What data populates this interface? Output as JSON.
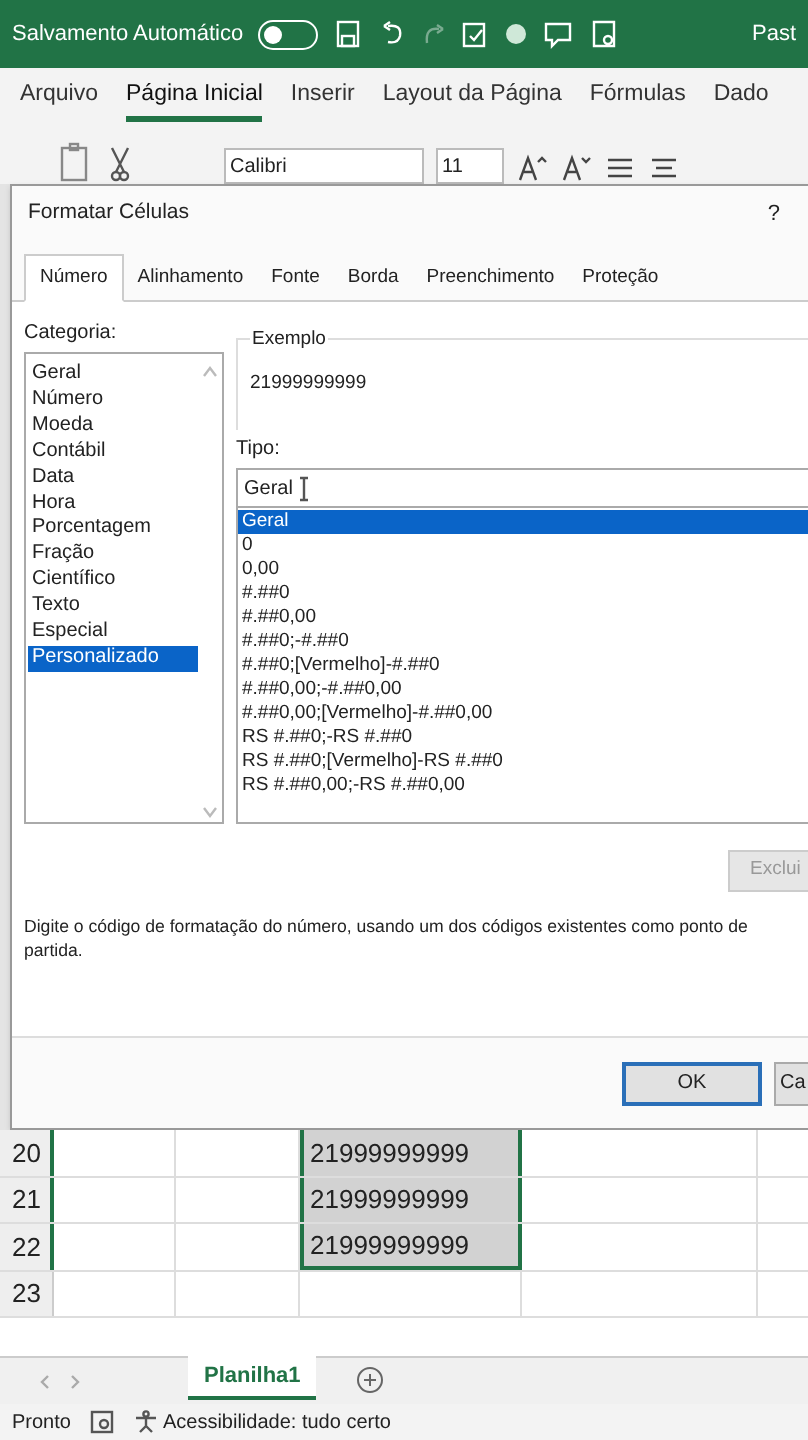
{
  "title_bar": {
    "autosave_label": "Salvamento Automático",
    "autosave_on": false,
    "title": "Past"
  },
  "ribbon_tabs": [
    {
      "label": "Arquivo",
      "selected": false
    },
    {
      "label": "Página Inicial",
      "selected": true
    },
    {
      "label": "Inserir",
      "selected": false
    },
    {
      "label": "Layout da Página",
      "selected": false
    },
    {
      "label": "Fórmulas",
      "selected": false
    },
    {
      "label": "Dado",
      "selected": false
    }
  ],
  "ribbon": {
    "font": "Calibri",
    "size": "11"
  },
  "dialog": {
    "title": "Formatar Células",
    "help": "?",
    "tabs": [
      {
        "label": "Número",
        "selected": true
      },
      {
        "label": "Alinhamento",
        "selected": false
      },
      {
        "label": "Fonte",
        "selected": false
      },
      {
        "label": "Borda",
        "selected": false
      },
      {
        "label": "Preenchimento",
        "selected": false
      },
      {
        "label": "Proteção",
        "selected": false
      }
    ],
    "category_label": "Categoria:",
    "categories": [
      {
        "label": "Geral",
        "selected": false
      },
      {
        "label": "Número",
        "selected": false
      },
      {
        "label": "Moeda",
        "selected": false
      },
      {
        "label": "Contábil",
        "selected": false
      },
      {
        "label": "Data",
        "selected": false
      },
      {
        "label": "Hora",
        "selected": false
      },
      {
        "label": "Porcentagem",
        "selected": false
      },
      {
        "label": "Fração",
        "selected": false
      },
      {
        "label": "Científico",
        "selected": false
      },
      {
        "label": "Texto",
        "selected": false
      },
      {
        "label": "Especial",
        "selected": false
      },
      {
        "label": "Personalizado",
        "selected": true
      }
    ],
    "sample_label": "Exemplo",
    "sample": "21999999999",
    "type_label": "Tipo:",
    "type_value": "Geral",
    "formats": [
      {
        "label": "Geral",
        "selected": true
      },
      {
        "label": "0",
        "selected": false
      },
      {
        "label": "0,00",
        "selected": false
      },
      {
        "label": "#.##0",
        "selected": false
      },
      {
        "label": "#.##0,00",
        "selected": false
      },
      {
        "label": "#.##0;-#.##0",
        "selected": false
      },
      {
        "label": "#.##0;[Vermelho]-#.##0",
        "selected": false
      },
      {
        "label": "#.##0,00;-#.##0,00",
        "selected": false
      },
      {
        "label": "#.##0,00;[Vermelho]-#.##0,00",
        "selected": false
      },
      {
        "label": "RS #.##0;-RS #.##0",
        "selected": false
      },
      {
        "label": "RS #.##0;[Vermelho]-RS #.##0",
        "selected": false
      },
      {
        "label": "RS #.##0,00;-RS #.##0,00",
        "selected": false
      }
    ],
    "delete_button": "Exclui",
    "description": [
      "Digite o código de formatação do número, usando um dos códigos existentes como ponto de",
      "partida."
    ],
    "ok": "OK",
    "cancel": "Ca"
  },
  "sheet": {
    "rows": [
      {
        "number": "20",
        "value": "21999999999",
        "selected": true
      },
      {
        "number": "21",
        "value": "21999999999",
        "selected": true
      },
      {
        "number": "22",
        "value": "21999999999",
        "selected": true
      },
      {
        "number": "23",
        "selected": false
      }
    ],
    "tabs": [
      {
        "label": "Planilha1",
        "selected": true
      }
    ]
  },
  "status_bar": {
    "state": "Pronto",
    "accessibility": "Acessibilidade: tudo certo"
  }
}
